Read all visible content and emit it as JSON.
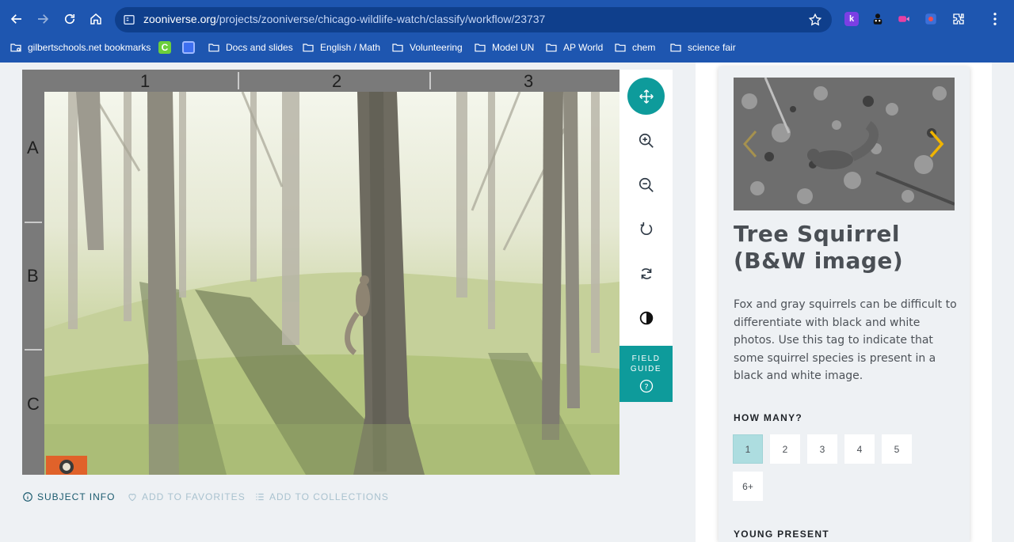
{
  "browser": {
    "url_host": "zooniverse.org",
    "url_path": "/projects/zooniverse/chicago-wildlife-watch/classify/workflow/23737",
    "bookmarks": [
      {
        "label": "gilbertschools.net bookmarks",
        "icon": "managed-bookmarks-icon"
      },
      {
        "label": "",
        "icon": "green-c-favicon"
      },
      {
        "label": "",
        "icon": "blue-favicon"
      },
      {
        "label": "Docs and slides",
        "icon": "folder-icon"
      },
      {
        "label": "English / Math",
        "icon": "folder-icon"
      },
      {
        "label": "Volunteering",
        "icon": "folder-icon"
      },
      {
        "label": "Model UN",
        "icon": "folder-icon"
      },
      {
        "label": "AP World",
        "icon": "folder-icon"
      },
      {
        "label": "chem",
        "icon": "folder-icon"
      },
      {
        "label": "science fair",
        "icon": "folder-icon"
      }
    ],
    "extension_k": "k"
  },
  "viewer": {
    "columns": [
      "1",
      "2",
      "3"
    ],
    "rows": [
      "A",
      "B",
      "C"
    ]
  },
  "toolbar": {
    "field_guide_line1": "FIELD",
    "field_guide_line2": "GUIDE",
    "field_guide_help": "?"
  },
  "meta": {
    "subject_info": "SUBJECT INFO",
    "add_to_favorites": "ADD TO FAVORITES",
    "add_to_collections": "ADD TO COLLECTIONS"
  },
  "species": {
    "title": "Tree Squirrel (B&W image)",
    "description": "Fox and gray squirrels can be difficult to differentiate with black and white photos. Use this tag to indicate that some squirrel species is present in a black and white image."
  },
  "questions": {
    "how_many": "HOW MANY?",
    "counts": [
      "1",
      "2",
      "3",
      "4",
      "5",
      "6+"
    ],
    "selected": "1",
    "young_present": "YOUNG PRESENT"
  },
  "colors": {
    "chrome": "#1e56b0",
    "accent_teal": "#0e9b9b",
    "selected_count": "#addde0"
  }
}
